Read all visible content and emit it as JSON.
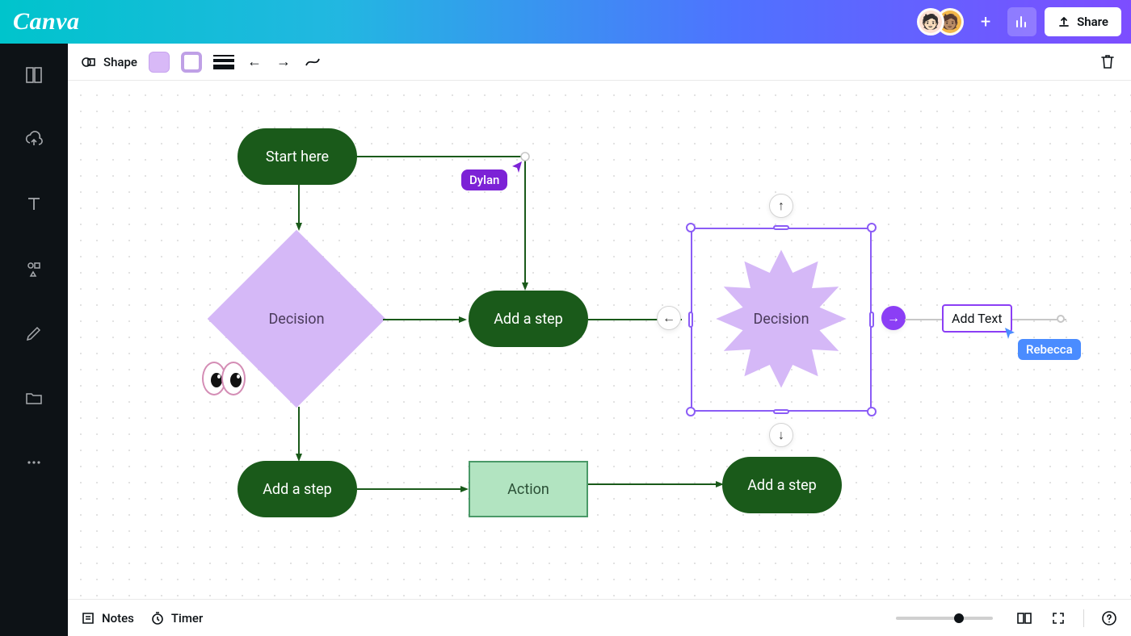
{
  "brand": "Canva",
  "topbar": {
    "share_label": "Share",
    "collaborators": [
      {
        "name": "Dylan"
      },
      {
        "name": "Rebecca"
      }
    ]
  },
  "toolbar": {
    "shape_label": "Shape",
    "fill_color": "#d8b9f7",
    "border_color": "#bfa0e6"
  },
  "canvas": {
    "nodes": {
      "start": {
        "label": "Start here",
        "type": "terminator"
      },
      "decision1": {
        "label": "Decision",
        "type": "decision"
      },
      "add_step_right": {
        "label": "Add a step",
        "type": "process"
      },
      "add_step_bottom": {
        "label": "Add a step",
        "type": "process"
      },
      "action": {
        "label": "Action",
        "type": "process"
      },
      "add_step_far": {
        "label": "Add a step",
        "type": "process"
      },
      "starburst": {
        "label": "Decision",
        "type": "decision-star"
      },
      "add_text": {
        "label": "Add Text"
      }
    },
    "cursors": {
      "dylan": {
        "label": "Dylan",
        "color": "#7c22d6"
      },
      "rebecca": {
        "label": "Rebecca",
        "color": "#4a8cff"
      }
    }
  },
  "footer": {
    "notes_label": "Notes",
    "timer_label": "Timer",
    "zoom_percent": 60
  }
}
